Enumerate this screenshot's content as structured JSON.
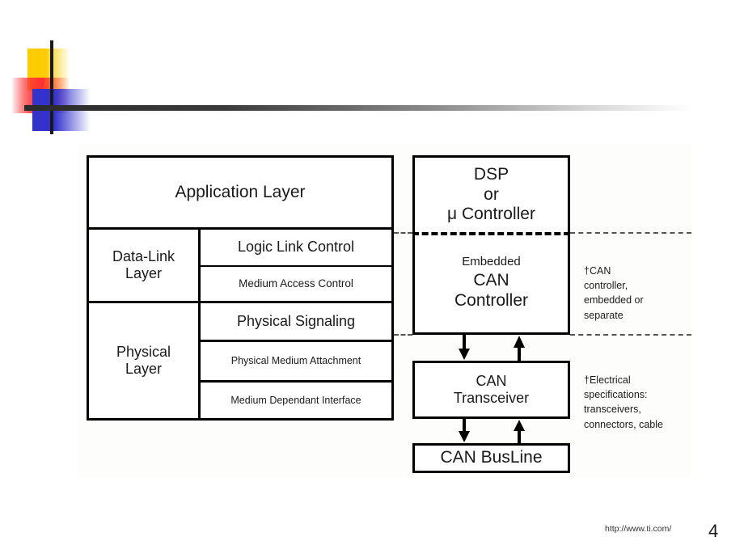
{
  "slide": {
    "number": "4",
    "footer_url": "http://www.ti.com/"
  },
  "osi_stack": {
    "application": {
      "label": "Application Layer"
    },
    "datalink": {
      "group_label": "Data-Link\nLayer",
      "sublayers": [
        {
          "label": "Logic Link Control"
        },
        {
          "label": "Medium Access Control"
        }
      ]
    },
    "physical": {
      "group_label": "Physical\nLayer",
      "sublayers": [
        {
          "label": "Physical Signaling"
        },
        {
          "label": "Physical Medium Attachment"
        },
        {
          "label": "Medium Dependant Interface"
        }
      ]
    }
  },
  "hardware_stack": {
    "processor": {
      "label": "DSP\nor\nμ Controller"
    },
    "can_controller": {
      "label_small": "Embedded",
      "label_large": "CAN\nController"
    },
    "transceiver": {
      "label": "CAN\nTransceiver"
    },
    "busline": {
      "label": "CAN BusLine"
    }
  },
  "annotations": [
    {
      "marker": "†",
      "text": "CAN\n controller,\n  embedded or\nseparate"
    },
    {
      "marker": "†",
      "text": "Electrical\n specifications:\n transceivers,\n connectors, cable"
    }
  ],
  "colors": {
    "logo_yellow": "#FFCC00",
    "logo_red": "#FF3333",
    "logo_blue": "#3333CC",
    "line_black": "#1a1a1a"
  }
}
